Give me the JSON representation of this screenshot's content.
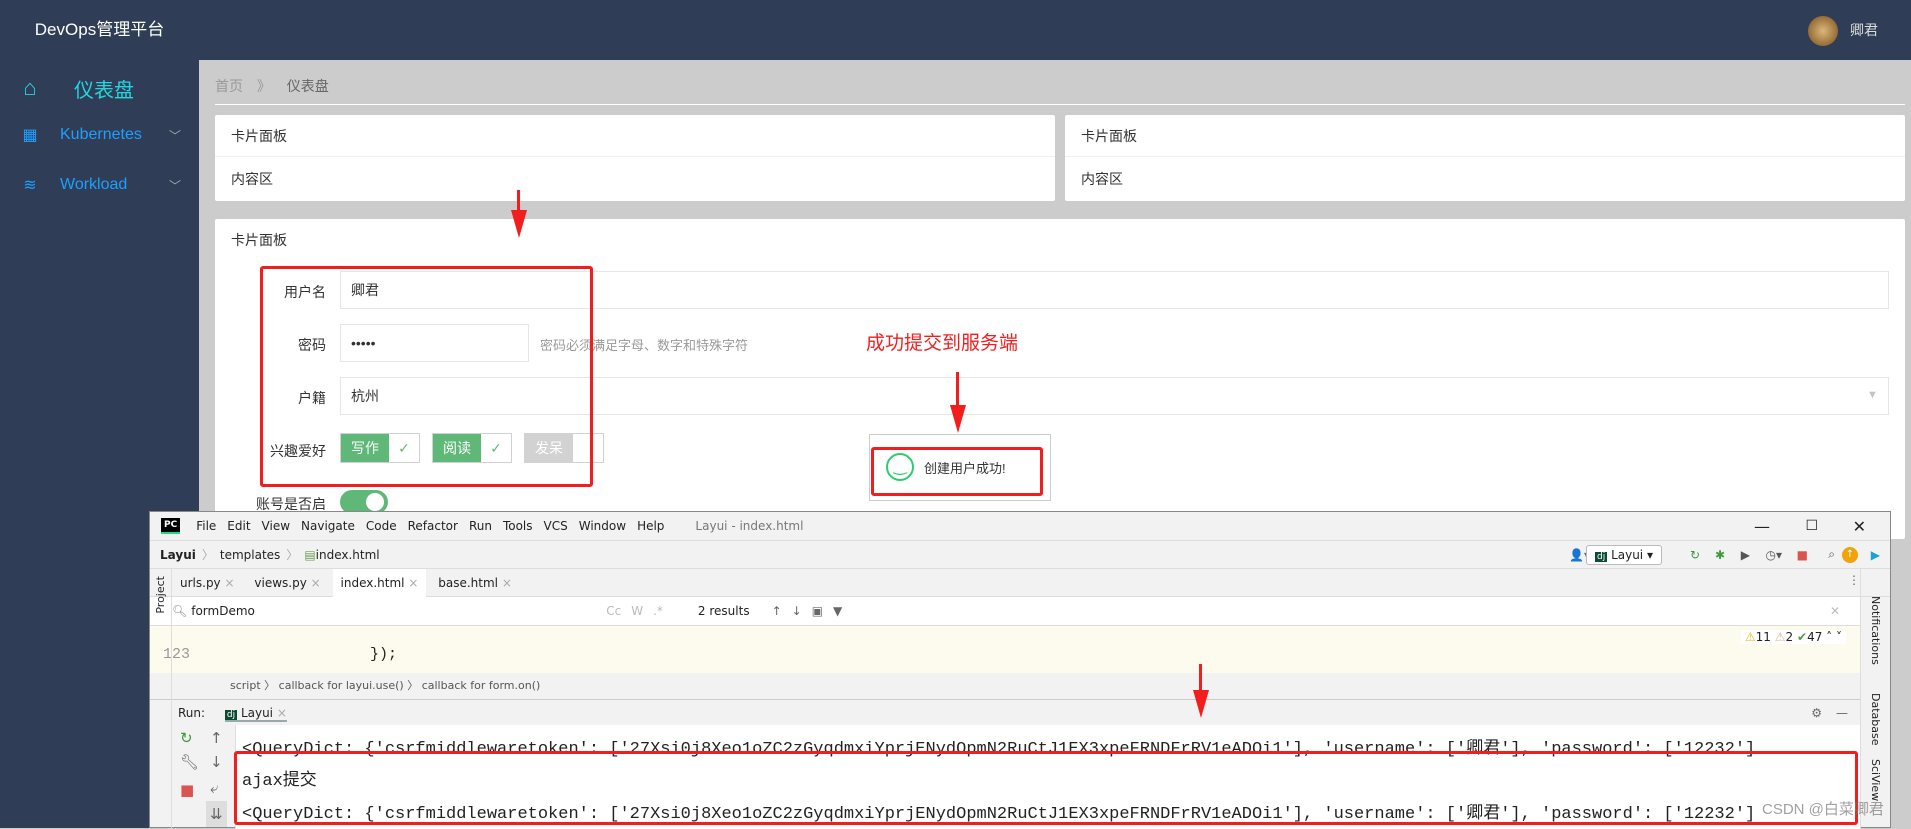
{
  "header": {
    "brand": "DevOps管理平台",
    "user": "卿君"
  },
  "sidebar": {
    "items": [
      {
        "label": "仪表盘",
        "icon": "home-icon"
      },
      {
        "label": "Kubernetes",
        "icon": "apps-icon"
      },
      {
        "label": "Workload",
        "icon": "layers-icon"
      }
    ]
  },
  "breadcrumb": {
    "home": "首页",
    "sep": "》",
    "current": "仪表盘"
  },
  "cards": [
    {
      "title": "卡片面板",
      "content": "内容区"
    },
    {
      "title": "卡片面板",
      "content": "内容区"
    }
  ],
  "form_card": {
    "title": "卡片面板",
    "username": {
      "label": "用户名",
      "value": "卿君"
    },
    "password": {
      "label": "密码",
      "value": "•••••",
      "hint": "密码必须满足字母、数字和特殊字符"
    },
    "hukou": {
      "label": "户籍",
      "value": "杭州"
    },
    "hobbies": {
      "label": "兴趣爱好",
      "options": [
        {
          "label": "写作",
          "checked": true
        },
        {
          "label": "阅读",
          "checked": true
        },
        {
          "label": "发呆",
          "checked": false
        }
      ]
    },
    "enabled": {
      "label": "账号是否启",
      "on": true
    }
  },
  "annotation": {
    "text": "成功提交到服务端",
    "color": "#f21e1e"
  },
  "toast": {
    "message": "创建用户成功!",
    "icon": "smile-icon"
  },
  "ide": {
    "logo": "PC",
    "menu": [
      "File",
      "Edit",
      "View",
      "Navigate",
      "Code",
      "Refactor",
      "Run",
      "Tools",
      "VCS",
      "Window",
      "Help"
    ],
    "title": "Layui - index.html",
    "path": [
      "Layui",
      "templates",
      "index.html"
    ],
    "run_config": "Layui",
    "tabs": [
      {
        "label": "urls.py",
        "active": false
      },
      {
        "label": "views.py",
        "active": false
      },
      {
        "label": "index.html",
        "active": true
      },
      {
        "label": "base.html",
        "active": false
      }
    ],
    "search": {
      "value": "formDemo",
      "results": "2 results",
      "cc": "Cc",
      "w": "W",
      "regex": ".*"
    },
    "inspections": {
      "warnings": "11",
      "weak": "2",
      "ok": "47"
    },
    "code": {
      "line_num": "123",
      "line_text": "});"
    },
    "code_breadcrumb": [
      "script",
      "callback for layui.use()",
      "callback for form.on()"
    ],
    "left_strip": "Project",
    "right_strip": [
      "Notifications",
      "Database",
      "SciView"
    ],
    "run": {
      "label": "Run:",
      "tab": "Layui",
      "output": [
        "<QueryDict: {'csrfmiddlewaretoken': ['27Xsi0j8Xeo1oZC2zGyqdmxiYprjENydOpmN2RuCtJ1EX3xpeFRNDFrRV1eADOi1'], 'username': ['卿君'], 'password': ['12232']",
        "ajax提交",
        "<QueryDict: {'csrfmiddlewaretoken': ['27Xsi0j8Xeo1oZC2zGyqdmxiYprjENydOpmN2RuCtJ1EX3xpeFRNDFrRV1eADOi1'], 'username': ['卿君'], 'password': ['12232']"
      ]
    }
  },
  "watermark": "CSDN @白菜卿君"
}
